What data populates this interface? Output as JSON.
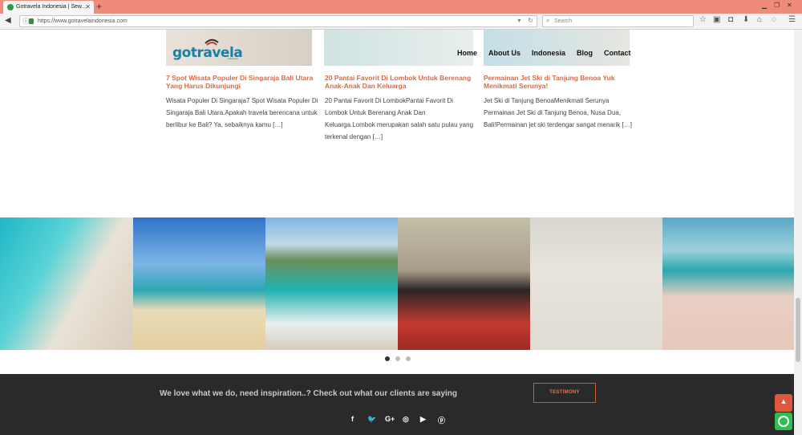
{
  "browser": {
    "tab_title": "Gotravela Indonesia | Sew...",
    "url": "https://www.gotravelaindonesia.com",
    "search_placeholder": "Search"
  },
  "site": {
    "logo_text": "gotravela",
    "logo_sub": "indonesia",
    "menu": [
      "Home",
      "About Us",
      "Indonesia",
      "Blog",
      "Contact"
    ]
  },
  "posts": [
    {
      "title": "7 Spot Wisata Populer Di Singaraja Bali Utara Yang Harus Dikunjungi",
      "excerpt": "Wisata Populer Di Singaraja7 Spot Wisata Populer Di Singaraja Bali Utara.Apakah travela berencana untuk berlibur ke Bali? Ya, sebaiknya kamu […]"
    },
    {
      "title": "20 Pantai Favorit Di Lombok Untuk Berenang Anak-Anak Dan Keluarga",
      "excerpt": "20 Pantai Favorit Di LombokPantai Favorit Di Lombok Untuk Berenang Anak Dan Keluarga.Lombok merupakan salah satu pulau yang terkenal dengan […]"
    },
    {
      "title": "Permainan Jet Ski di Tanjung Benoa Yuk Menikmati Serunya!",
      "excerpt": "Jet Ski di Tanjung BenoaMenikmati Serunya Permainan Jet Ski di Tanjung Benoa, Nusa Dua, Bali!Permainan jet ski terdengar sangat menarik […]"
    }
  ],
  "gallery": {
    "images": [
      "aerial-beach-image",
      "beach-driftwood-image",
      "coastline-image",
      "couple-scooter-image",
      "woman-sand-image",
      "bicycle-beach-image"
    ],
    "active_dot": 1,
    "dot_count": 3
  },
  "footer": {
    "tagline": "We love what we do, need inspiration..? Check out what our clients are saying",
    "button": "TESTIMONY",
    "social": [
      "facebook-icon",
      "twitter-icon",
      "google-plus-icon",
      "tripadvisor-icon",
      "youtube-icon",
      "pinterest-icon"
    ]
  },
  "colors": {
    "accent": "#d76a45",
    "footer_bg": "#2a2a2a",
    "whatsapp": "#2fbe50"
  }
}
